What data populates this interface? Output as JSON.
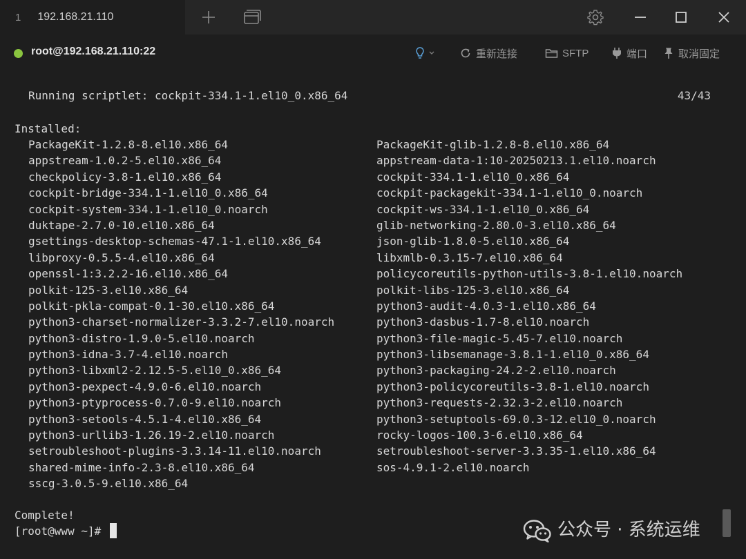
{
  "tabbar": {
    "tab_index": "1",
    "tab_title": "192.168.21.110"
  },
  "session": {
    "title": "root@192.168.21.110:22",
    "status_color": "#8ac43f",
    "tools": {
      "reconnect_label": "重新连接",
      "sftp_label": "SFTP",
      "port_label": "端口",
      "unpin_label": "取消固定"
    }
  },
  "terminal": {
    "scriptlet_text": "Running scriptlet: cockpit-334.1-1.el10_0.x86_64",
    "scriptlet_count": "43/43",
    "installed_header": "Installed:",
    "packages": [
      {
        "left": "PackageKit-1.2.8-8.el10.x86_64",
        "right": "PackageKit-glib-1.2.8-8.el10.x86_64"
      },
      {
        "left": "appstream-1.0.2-5.el10.x86_64",
        "right": "appstream-data-1:10-20250213.1.el10.noarch"
      },
      {
        "left": "checkpolicy-3.8-1.el10.x86_64",
        "right": "cockpit-334.1-1.el10_0.x86_64"
      },
      {
        "left": "cockpit-bridge-334.1-1.el10_0.x86_64",
        "right": "cockpit-packagekit-334.1-1.el10_0.noarch"
      },
      {
        "left": "cockpit-system-334.1-1.el10_0.noarch",
        "right": "cockpit-ws-334.1-1.el10_0.x86_64"
      },
      {
        "left": "duktape-2.7.0-10.el10.x86_64",
        "right": "glib-networking-2.80.0-3.el10.x86_64"
      },
      {
        "left": "gsettings-desktop-schemas-47.1-1.el10.x86_64",
        "right": "json-glib-1.8.0-5.el10.x86_64"
      },
      {
        "left": "libproxy-0.5.5-4.el10.x86_64",
        "right": "libxmlb-0.3.15-7.el10.x86_64"
      },
      {
        "left": "openssl-1:3.2.2-16.el10.x86_64",
        "right": "policycoreutils-python-utils-3.8-1.el10.noarch"
      },
      {
        "left": "polkit-125-3.el10.x86_64",
        "right": "polkit-libs-125-3.el10.x86_64"
      },
      {
        "left": "polkit-pkla-compat-0.1-30.el10.x86_64",
        "right": "python3-audit-4.0.3-1.el10.x86_64"
      },
      {
        "left": "python3-charset-normalizer-3.3.2-7.el10.noarch",
        "right": "python3-dasbus-1.7-8.el10.noarch"
      },
      {
        "left": "python3-distro-1.9.0-5.el10.noarch",
        "right": "python3-file-magic-5.45-7.el10.noarch"
      },
      {
        "left": "python3-idna-3.7-4.el10.noarch",
        "right": "python3-libsemanage-3.8.1-1.el10_0.x86_64"
      },
      {
        "left": "python3-libxml2-2.12.5-5.el10_0.x86_64",
        "right": "python3-packaging-24.2-2.el10.noarch"
      },
      {
        "left": "python3-pexpect-4.9.0-6.el10.noarch",
        "right": "python3-policycoreutils-3.8-1.el10.noarch"
      },
      {
        "left": "python3-ptyprocess-0.7.0-9.el10.noarch",
        "right": "python3-requests-2.32.3-2.el10.noarch"
      },
      {
        "left": "python3-setools-4.5.1-4.el10.x86_64",
        "right": "python3-setuptools-69.0.3-12.el10_0.noarch"
      },
      {
        "left": "python3-urllib3-1.26.19-2.el10.noarch",
        "right": "rocky-logos-100.3-6.el10.x86_64"
      },
      {
        "left": "setroubleshoot-plugins-3.3.14-11.el10.noarch",
        "right": "setroubleshoot-server-3.3.35-1.el10.x86_64"
      },
      {
        "left": "shared-mime-info-2.3-8.el10.x86_64",
        "right": "sos-4.9.1-2.el10.noarch"
      },
      {
        "left": "sscg-3.0.5-9.el10.x86_64",
        "right": ""
      }
    ],
    "complete_text": "Complete!",
    "prompt_text": "[root@www ~]#"
  },
  "watermark": {
    "text": "公众号 · 系统运维"
  },
  "icons": {
    "new_tab": "plus-icon",
    "window_list": "window-list-icon",
    "settings": "gear-icon",
    "minimize": "minimize-icon",
    "maximize": "maximize-icon",
    "close": "close-icon",
    "hint": "lightbulb-icon",
    "reconnect": "refresh-icon",
    "sftp": "folder-icon",
    "port": "plug-icon",
    "unpin": "pin-icon",
    "watermark": "wechat-icon"
  }
}
